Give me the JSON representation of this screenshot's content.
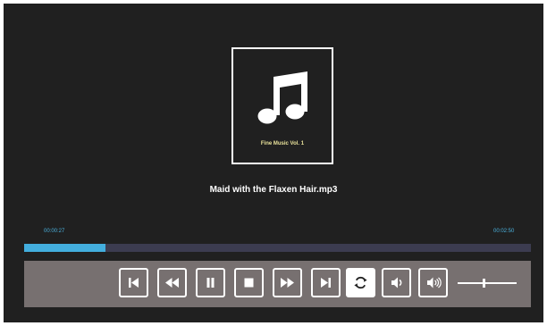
{
  "album": {
    "title": "Fine Music Vol. 1",
    "art_icon": "music-note-icon"
  },
  "track": {
    "title": "Maid with the Flaxen  Hair.mp3"
  },
  "time": {
    "elapsed": "00:00:27",
    "total": "00:02:50"
  },
  "progress": {
    "fraction": 0.16
  },
  "controls": [
    {
      "name": "skip-previous-button",
      "icon": "skip-previous-icon"
    },
    {
      "name": "rewind-button",
      "icon": "rewind-icon"
    },
    {
      "name": "pause-button",
      "icon": "pause-icon"
    },
    {
      "name": "stop-button",
      "icon": "stop-icon"
    },
    {
      "name": "fast-forward-button",
      "icon": "fast-forward-icon"
    },
    {
      "name": "skip-next-button",
      "icon": "skip-next-icon"
    },
    {
      "name": "repeat-button",
      "icon": "repeat-icon",
      "active": true
    },
    {
      "name": "volume-down-button",
      "icon": "volume-down-icon"
    },
    {
      "name": "volume-up-button",
      "icon": "volume-up-icon"
    }
  ],
  "volume": {
    "level": 0.45
  },
  "colors": {
    "background": "#202020",
    "accent": "#43aede",
    "progress_track": "#3c3c50",
    "controls_bar": "#777070",
    "album_title": "#e8e19a"
  }
}
